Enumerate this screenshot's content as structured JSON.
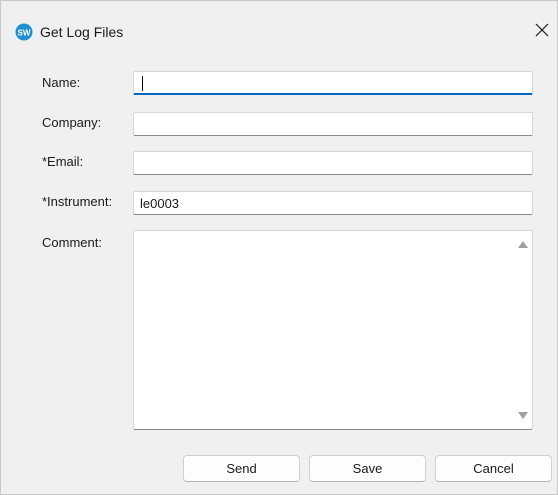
{
  "window": {
    "title": "Get Log Files",
    "app_icon": "sw-logo-icon",
    "close_glyph": "✕"
  },
  "form": {
    "name": {
      "label": "Name:",
      "value": ""
    },
    "company": {
      "label": "Company:",
      "value": ""
    },
    "email": {
      "label": "*Email:",
      "value": ""
    },
    "instrument": {
      "label": "*Instrument:",
      "value": "le0003"
    },
    "comment": {
      "label": "Comment:",
      "value": ""
    }
  },
  "buttons": {
    "send": "Send",
    "save": "Save",
    "cancel": "Cancel"
  },
  "colors": {
    "accent": "#0067c0",
    "window_bg": "#f0f0f0",
    "icon_bg": "#1f8fd1"
  }
}
